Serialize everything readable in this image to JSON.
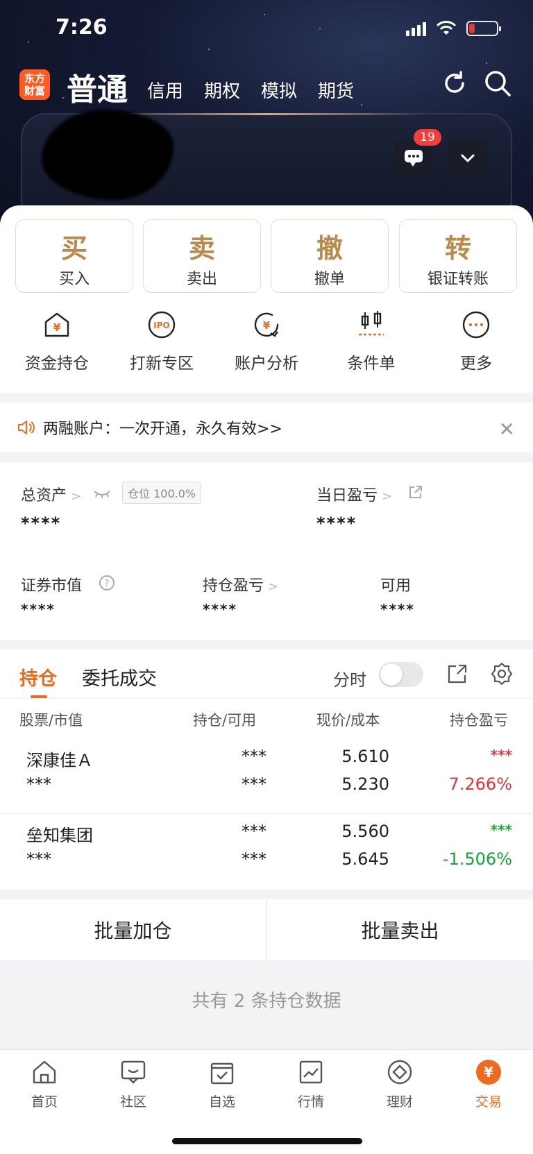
{
  "status": {
    "time": "7:26"
  },
  "colors": {
    "accent": "#EE6A1E",
    "gold": "#B98A4A",
    "up": "#E4323B",
    "down": "#17A334",
    "badge": "#F23D3D"
  },
  "nav": {
    "logo": [
      "东方",
      "财富"
    ],
    "tabs": [
      "普通",
      "信用",
      "期权",
      "模拟",
      "期货"
    ],
    "icons": [
      "refresh-icon",
      "search-icon"
    ]
  },
  "account_card": {
    "messages_badge": "19"
  },
  "trade_buttons": [
    {
      "char": "买",
      "label": "买入"
    },
    {
      "char": "卖",
      "label": "卖出"
    },
    {
      "char": "撤",
      "label": "撤单"
    },
    {
      "char": "转",
      "label": "银证转账"
    }
  ],
  "quick_actions": [
    {
      "label": "资金持仓",
      "icon": "fund-house-icon"
    },
    {
      "label": "打新专区",
      "icon": "ipo-icon"
    },
    {
      "label": "账户分析",
      "icon": "analysis-icon"
    },
    {
      "label": "条件单",
      "icon": "condition-icon"
    },
    {
      "label": "更多",
      "icon": "more-icon"
    }
  ],
  "notice": {
    "text": "两融账户：一次开通，永久有效>>"
  },
  "assets": {
    "total_label": "总资产",
    "position_chip": "仓位 100.0%",
    "total_value": "****",
    "daily_label": "当日盈亏",
    "daily_value": "****",
    "market_label": "证券市值",
    "market_value": "****",
    "holding_pl_label": "持仓盈亏",
    "holding_pl_value": "****",
    "available_label": "可用",
    "available_value": "****"
  },
  "holdings": {
    "tab_active": "持仓",
    "tab_other": "委托成交",
    "toggle_label": "分时",
    "columns": [
      "股票/市值",
      "持仓/可用",
      "现价/成本",
      "持仓盈亏"
    ],
    "rows": [
      {
        "name": "深康佳Ａ",
        "market": "***",
        "position": "***",
        "available": "***",
        "price": "5.610",
        "cost": "5.230",
        "pl": "***",
        "pl_pct": "7.266%",
        "trend": "up"
      },
      {
        "name": "垒知集团",
        "market": "***",
        "position": "***",
        "available": "***",
        "price": "5.560",
        "cost": "5.645",
        "pl": "***",
        "pl_pct": "-1.506%",
        "trend": "down"
      }
    ]
  },
  "actions": {
    "batch_add": "批量加仓",
    "batch_sell": "批量卖出"
  },
  "footer": {
    "summary": "共有 2 条持仓数据"
  },
  "tabbar": [
    {
      "label": "首页",
      "icon": "home-icon"
    },
    {
      "label": "社区",
      "icon": "community-icon"
    },
    {
      "label": "自选",
      "icon": "watchlist-icon"
    },
    {
      "label": "行情",
      "icon": "market-icon"
    },
    {
      "label": "理财",
      "icon": "wealth-icon"
    },
    {
      "label": "交易",
      "icon": "trade-icon",
      "active": true
    }
  ]
}
